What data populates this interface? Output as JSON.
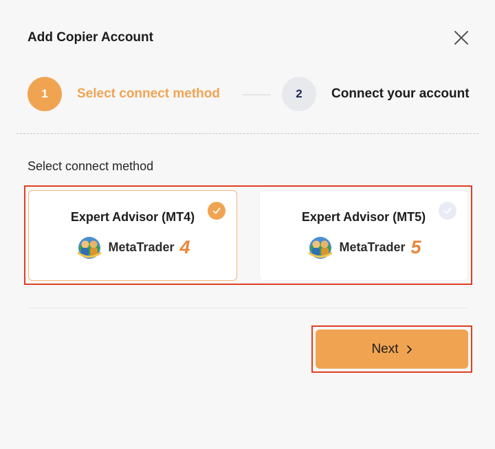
{
  "dialog": {
    "title": "Add Copier Account"
  },
  "steps": [
    {
      "number": "1",
      "label": "Select connect method",
      "state": "active"
    },
    {
      "number": "2",
      "label": "Connect your account",
      "state": "pending"
    }
  ],
  "section": {
    "label": "Select connect method"
  },
  "options": [
    {
      "title": "Expert Advisor (MT4)",
      "brand": "MetaTrader",
      "version": "4",
      "selected": true
    },
    {
      "title": "Expert Advisor (MT5)",
      "brand": "MetaTrader",
      "version": "5",
      "selected": false
    }
  ],
  "actions": {
    "next_label": "Next"
  },
  "colors": {
    "accent": "#f0a452",
    "highlight": "#e03e22"
  },
  "icons": {
    "close": "close-icon",
    "check": "check-icon",
    "next": "chevron-right-icon"
  }
}
